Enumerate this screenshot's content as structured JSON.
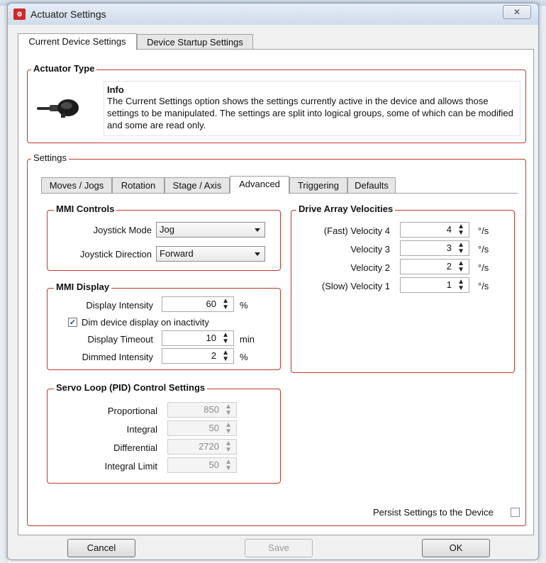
{
  "window": {
    "title": "Actuator Settings",
    "close_symbol": "✕"
  },
  "top_tabs": [
    {
      "label": "Current Device Settings",
      "active": true
    },
    {
      "label": "Device Startup Settings",
      "active": false
    }
  ],
  "actuator_type": {
    "legend": "Actuator Type",
    "info_title": "Info",
    "info_text": "The Current Settings option shows the settings currently active in the device and allows those settings to be manipulated. The settings are split into logical groups, some of which can be modified and some are read only.",
    "image_icon": "actuator-device-icon"
  },
  "settings": {
    "legend": "Settings",
    "tabs": [
      {
        "label": "Moves / Jogs",
        "active": false
      },
      {
        "label": "Rotation",
        "active": false
      },
      {
        "label": "Stage / Axis",
        "active": false
      },
      {
        "label": "Advanced",
        "active": true
      },
      {
        "label": "Triggering",
        "active": false
      },
      {
        "label": "Defaults",
        "active": false
      }
    ]
  },
  "mmi_controls": {
    "legend": "MMI Controls",
    "joystick_mode_label": "Joystick Mode",
    "joystick_mode_value": "Jog",
    "joystick_direction_label": "Joystick Direction",
    "joystick_direction_value": "Forward"
  },
  "mmi_display": {
    "legend": "MMI Display",
    "display_intensity_label": "Display Intensity",
    "display_intensity_value": "60",
    "display_intensity_unit": "%",
    "dim_checkbox_label": "Dim device display on inactivity",
    "dim_checked": true,
    "display_timeout_label": "Display Timeout",
    "display_timeout_value": "10",
    "display_timeout_unit": "min",
    "dimmed_intensity_label": "Dimmed Intensity",
    "dimmed_intensity_value": "2",
    "dimmed_intensity_unit": "%"
  },
  "servo_loop": {
    "legend": "Servo Loop (PID) Control Settings",
    "proportional_label": "Proportional",
    "proportional_value": "850",
    "integral_label": "Integral",
    "integral_value": "50",
    "differential_label": "Differential",
    "differential_value": "2720",
    "integral_limit_label": "Integral Limit",
    "integral_limit_value": "50"
  },
  "drive_array": {
    "legend": "Drive Array Velocities",
    "rows": [
      {
        "label": "(Fast) Velocity 4",
        "value": "4",
        "unit": "°/s"
      },
      {
        "label": "Velocity 3",
        "value": "3",
        "unit": "°/s"
      },
      {
        "label": "Velocity 2",
        "value": "2",
        "unit": "°/s"
      },
      {
        "label": "(Slow) Velocity 1",
        "value": "1",
        "unit": "°/s"
      }
    ]
  },
  "persist": {
    "label": "Persist Settings to the Device",
    "checked": false
  },
  "buttons": {
    "cancel": "Cancel",
    "save": "Save",
    "ok": "OK"
  },
  "spinner_glyph": "⌃⌄",
  "colors": {
    "group_border": "#c0392b",
    "titlebar": "#cfdbea"
  }
}
